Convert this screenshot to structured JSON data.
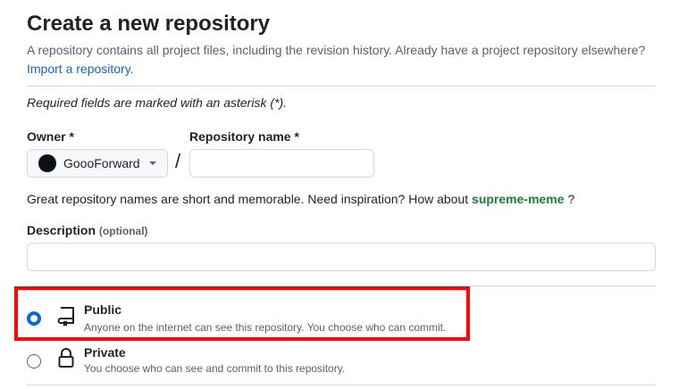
{
  "header": {
    "title": "Create a new repository",
    "subtitle": "A repository contains all project files, including the revision history. Already have a project repository elsewhere?",
    "import_link": "Import a repository."
  },
  "form": {
    "required_note": "Required fields are marked with an asterisk (*).",
    "owner": {
      "label": "Owner *",
      "value": "GoooForward"
    },
    "separator": "/",
    "repo_name": {
      "label": "Repository name *",
      "value": "",
      "placeholder": ""
    },
    "name_hint_prefix": "Great repository names are short and memorable. Need inspiration? How about",
    "name_suggestion": "supreme-meme",
    "name_hint_suffix": "?",
    "description": {
      "label": "Description",
      "optional": "(optional)",
      "value": ""
    }
  },
  "visibility": {
    "selected": "public",
    "options": [
      {
        "title": "Public",
        "description": "Anyone on the internet can see this repository. You choose who can commit.",
        "icon": "repo-icon"
      },
      {
        "title": "Private",
        "description": "You choose who can see and commit to this repository.",
        "icon": "lock-icon"
      }
    ]
  },
  "colors": {
    "link": "#0969da",
    "suggestion": "#1a7f37",
    "highlight": "#ff0000",
    "radio_checked": "#0969da"
  }
}
